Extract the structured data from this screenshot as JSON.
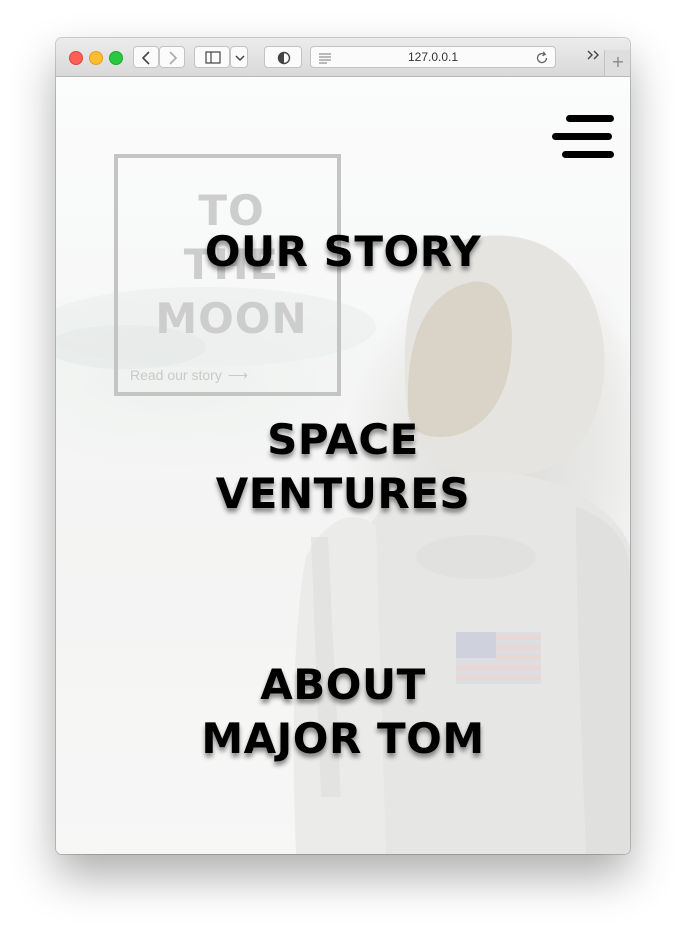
{
  "browser": {
    "url": "127.0.0.1",
    "new_tab_label": "+"
  },
  "hero": {
    "title_lines": [
      "TO",
      "THE",
      "MOON"
    ],
    "link_text": "Read our story",
    "link_arrow": "⟶"
  },
  "menu": {
    "items": [
      {
        "lines": [
          "OUR STORY"
        ]
      },
      {
        "lines": [
          "SPACE",
          "VENTURES"
        ]
      },
      {
        "lines": [
          "ABOUT",
          "MAJOR TOM"
        ]
      }
    ]
  },
  "icons": {
    "hamburger": "hamburger-menu-icon",
    "back": "chevron-left-icon",
    "forward": "chevron-right-icon",
    "sidebar": "sidebar-icon",
    "privacy": "shield-icon",
    "reader": "reader-lines-icon",
    "reload": "reload-icon",
    "more": "double-chevron-icon"
  }
}
